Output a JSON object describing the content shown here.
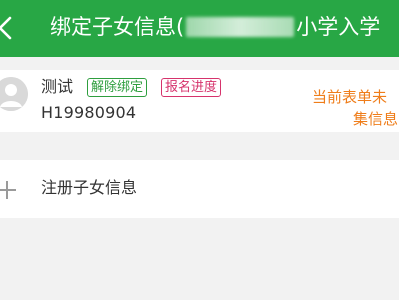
{
  "header": {
    "title_prefix": "绑定子女信息(",
    "title_suffix": "小学入学",
    "bg_color": "#28a745",
    "back_icon": "chevron-left-icon"
  },
  "child": {
    "name": "测试",
    "id_number": "H19980904",
    "avatar_icon": "user-avatar-icon",
    "actions": {
      "unbind_label": "解除绑定",
      "progress_label": "报名进度"
    },
    "notice_line1": "当前表单未",
    "notice_line2": "集信息"
  },
  "register": {
    "label": "注册子女信息",
    "icon": "plus-icon"
  },
  "colors": {
    "unbind": "#2e9e3e",
    "progress": "#d6336c",
    "notice": "#ef7d1a"
  }
}
